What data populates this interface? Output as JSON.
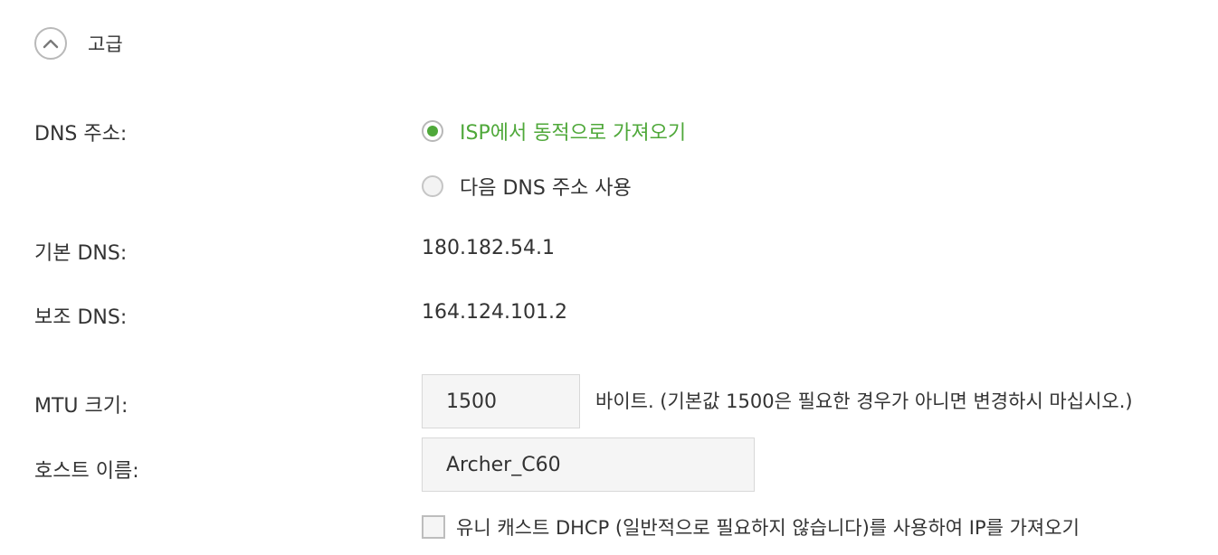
{
  "advanced": {
    "label": "고급",
    "icon": "chevron-up-icon"
  },
  "dns": {
    "label": "DNS 주소:",
    "options": [
      {
        "label": "ISP에서 동적으로 가져오기",
        "checked": true
      },
      {
        "label": "다음 DNS 주소 사용",
        "checked": false
      }
    ],
    "primary_label": "기본 DNS:",
    "primary_value": "180.182.54.1",
    "secondary_label": "보조 DNS:",
    "secondary_value": "164.124.101.2"
  },
  "mtu": {
    "label": "MTU 크기:",
    "value": "1500",
    "hint": "바이트. (기본값 1500은 필요한 경우가 아니면 변경하시 마십시오.)"
  },
  "hostname": {
    "label": "호스트 이름:",
    "value": "Archer_C60"
  },
  "unicast": {
    "label": "유니 캐스트 DHCP (일반적으로 필요하지 않습니다)를 사용하여 IP를 가져오기",
    "checked": false
  },
  "colors": {
    "accent": "#4fa83a",
    "text": "#333333",
    "input_bg": "#f5f5f5"
  }
}
